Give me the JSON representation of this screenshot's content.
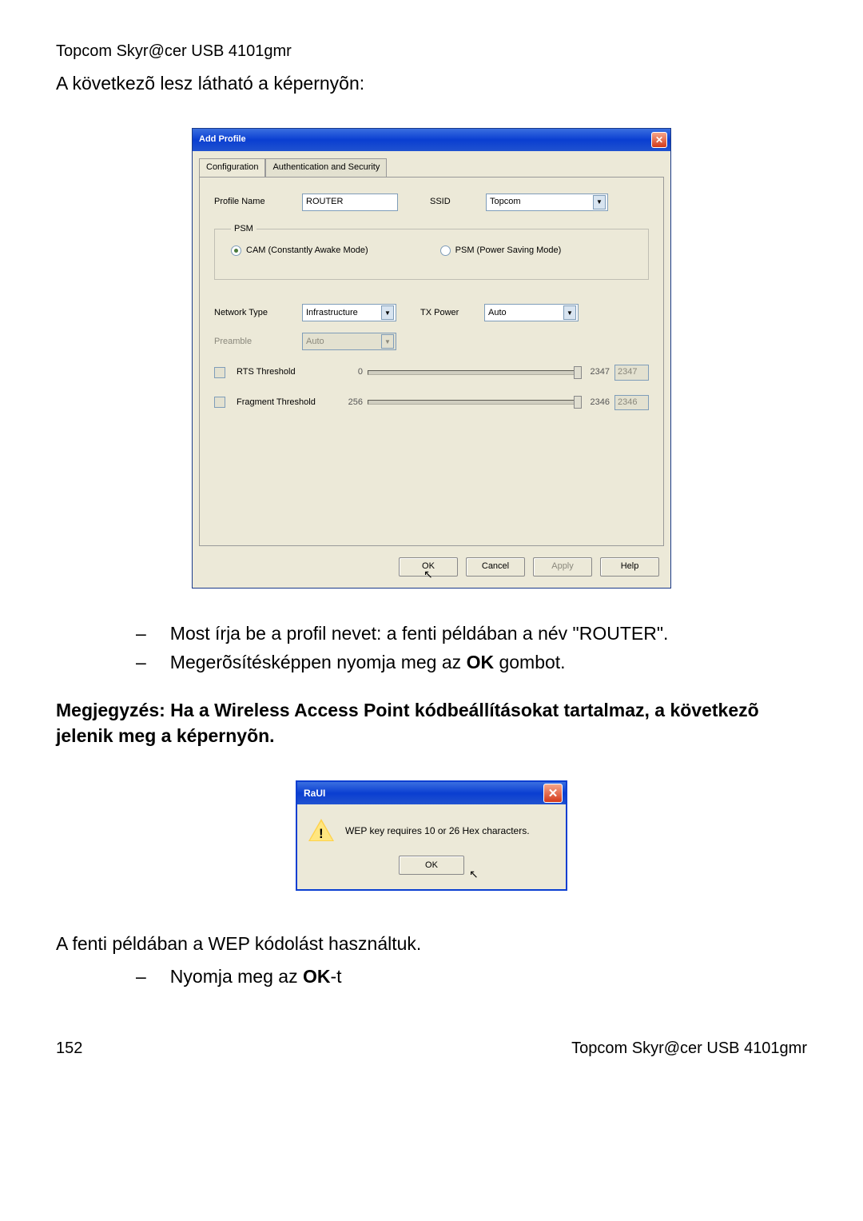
{
  "header_product": "Topcom Skyr@cer USB 4101gmr",
  "intro_text": "A következõ lesz látható a képernyõn:",
  "add_profile": {
    "title": "Add Profile",
    "tabs": {
      "config": "Configuration",
      "auth": "Authentication and Security"
    },
    "labels": {
      "profile_name": "Profile Name",
      "ssid": "SSID",
      "psm_legend": "PSM",
      "cam": "CAM (Constantly Awake Mode)",
      "psm": "PSM (Power Saving Mode)",
      "network_type": "Network Type",
      "tx_power": "TX Power",
      "preamble": "Preamble",
      "rts": "RTS Threshold",
      "frag": "Fragment Threshold"
    },
    "values": {
      "profile_name": "ROUTER",
      "ssid": "Topcom",
      "network_type": "Infrastructure",
      "tx_power": "Auto",
      "preamble": "Auto",
      "rts_min": "0",
      "rts_max": "2347",
      "rts_val": "2347",
      "frag_min": "256",
      "frag_max": "2346",
      "frag_val": "2346"
    },
    "buttons": {
      "ok": "OK",
      "cancel": "Cancel",
      "apply": "Apply",
      "help": "Help"
    }
  },
  "bullets": {
    "b1": "Most írja be a profil nevet: a fenti példában a név \"ROUTER\".",
    "b2_pre": "Megerõsítésképpen nyomja meg az ",
    "b2_bold": "OK",
    "b2_post": " gombot."
  },
  "note": "Megjegyzés: Ha a Wireless Access Point kódbeállításokat tartalmaz, a következõ jelenik meg a képernyõn.",
  "raui": {
    "title": "RaUI",
    "message": "WEP key requires 10 or 26 Hex characters.",
    "ok": "OK"
  },
  "after_raui": "A fenti példában a WEP kódolást használtuk.",
  "bullet3_pre": "Nyomja meg az ",
  "bullet3_bold": "OK",
  "bullet3_post": "-t",
  "page_number": "152"
}
